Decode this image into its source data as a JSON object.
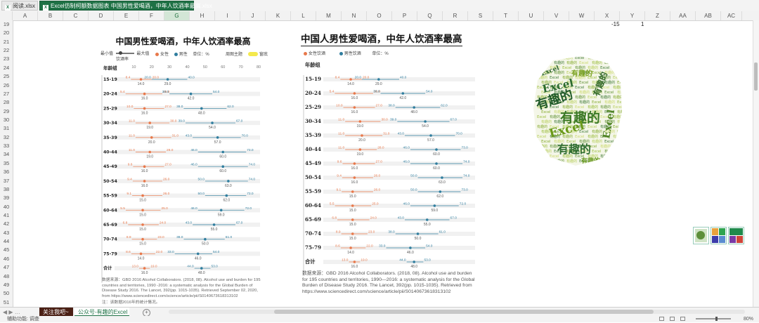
{
  "file_tabs": [
    {
      "label": "阅读.xlsx",
      "active": false
    },
    {
      "label": "Excel仿制柯额数据图表 中国男性爱喝酒，中年人饮酒率最高.xlsx",
      "active": true
    }
  ],
  "columns": [
    "A",
    "B",
    "C",
    "D",
    "E",
    "F",
    "G",
    "H",
    "I",
    "J",
    "K",
    "L",
    "M",
    "N",
    "O",
    "P",
    "Q",
    "R",
    "S",
    "T",
    "U",
    "V",
    "W",
    "X",
    "Y",
    "Z",
    "AA",
    "AB",
    "AC"
  ],
  "selected_column": "G",
  "rows": [
    "19",
    "20",
    "21",
    "22",
    "23",
    "24",
    "25",
    "26",
    "27",
    "28",
    "29",
    "30",
    "31",
    "32",
    "33",
    "34",
    "35",
    "36",
    "37",
    "38",
    "39",
    "40",
    "41",
    "42",
    "43",
    "44",
    "45",
    "46",
    "47",
    "48",
    "49",
    "50",
    "51"
  ],
  "cell_values": {
    "x": "-15",
    "y": "1"
  },
  "chart1": {
    "title": "中国男性爱喝酒，中年人饮酒率最高",
    "slider": {
      "min_label": "最小值",
      "max_label": "最大值",
      "caption": "饮酒率"
    },
    "legend": {
      "female": "女性",
      "male": "男性",
      "unit": "单位：%"
    },
    "toggle": {
      "left": "周图主题",
      "right": "窗底"
    },
    "axis_ticks": [
      "0",
      "10",
      "20",
      "30",
      "40",
      "50",
      "60",
      "70",
      "80"
    ],
    "header": "年龄组",
    "source": "数据来源：GBD 2016 Alcohol Collaborators. (2018, 08). Alcohol use and burden for 195 countries and territories, 1990 -2016: a systematic analysis for the Global Burden of Disease Study 2016. The Lancet, 392(pp. 1015-1035). Retrieved September 02, 2020, from https://www.sciencedirect.com/science/article/pii/S0140673618313102",
    "footnote": "注：该数据2016年的统计情况。"
  },
  "chart2": {
    "title": "中国人男性爱喝酒，中年人饮酒率最高",
    "legend": {
      "female": "女性饮酒",
      "male": "男性饮酒",
      "unit": "单位：%"
    },
    "header": "年龄组",
    "source": "数据来源：GBD 2016 Alcohol Collaborators. (2018, 08). Alcohol use and burden for 195 countries and territories, 1990—2016: a systematic analysis for the Global Burden of Disease Study 2016. The Lancet, 392(pp. 1015-1035). Retrieved from https://www.sciencedirect.com/science/article/pii/S0140673618313102"
  },
  "chart_data": {
    "type": "scatter",
    "title": "中国男性爱喝酒，中年人饮酒率最高",
    "ylabel": "年龄组",
    "xlim": [
      0,
      80
    ],
    "categories": [
      "15-19",
      "20-24",
      "25-29",
      "30-34",
      "35-39",
      "40-44",
      "45-49",
      "50-54",
      "55-59",
      "60-64",
      "65-69",
      "70-74",
      "75-79",
      "合计"
    ],
    "series": [
      {
        "name": "女性",
        "low": [
          8.4,
          5.4,
          10.0,
          11.0,
          11.0,
          11.0,
          9.6,
          9.4,
          9.1,
          5.5,
          6.8,
          8.9,
          8.6,
          13.0
        ],
        "mid": [
          14.0,
          16.0,
          16.0,
          19.0,
          20.0,
          19.0,
          16.0,
          16.0,
          15.0,
          15.0,
          15.0,
          15.0,
          14.0,
          16.0
        ],
        "high": [
          20.0,
          26.0,
          27.0,
          30.0,
          31.0,
          28.0,
          27.0,
          26.0,
          26.0,
          25.0,
          24.0,
          23.0,
          22.0,
          19.0
        ]
      },
      {
        "name": "男性",
        "low": [
          20.0,
          30.0,
          38.0,
          39.0,
          43.0,
          46.0,
          46.0,
          50.0,
          50.0,
          46.0,
          43.0,
          38.0,
          33.0,
          44.0
        ],
        "mid": [
          29.0,
          42.0,
          48.0,
          54.0,
          57.0,
          60.0,
          60.0,
          63.0,
          62.0,
          59.0,
          55.0,
          50.0,
          46.0,
          48.0
        ],
        "high": [
          40.0,
          54.0,
          62.0,
          67.0,
          70.0,
          73.0,
          74.0,
          74.0,
          73.0,
          72.0,
          67.0,
          61.0,
          54.0,
          53.0
        ]
      }
    ],
    "colors": {
      "female": "#e8784a",
      "male": "#2f7d9e"
    }
  },
  "wordcloud_words": [
    "有趣的",
    "Excel",
    "有趣的",
    "Excel",
    "有趣的",
    "有趣的",
    "Excel",
    "有趣的",
    "Excel",
    "有趣的"
  ],
  "sheet_tabs": [
    "关注我吧~",
    "公众号-有趣的Excel"
  ],
  "status": {
    "text": "辅助功能: 调查",
    "zoom": "80%"
  }
}
